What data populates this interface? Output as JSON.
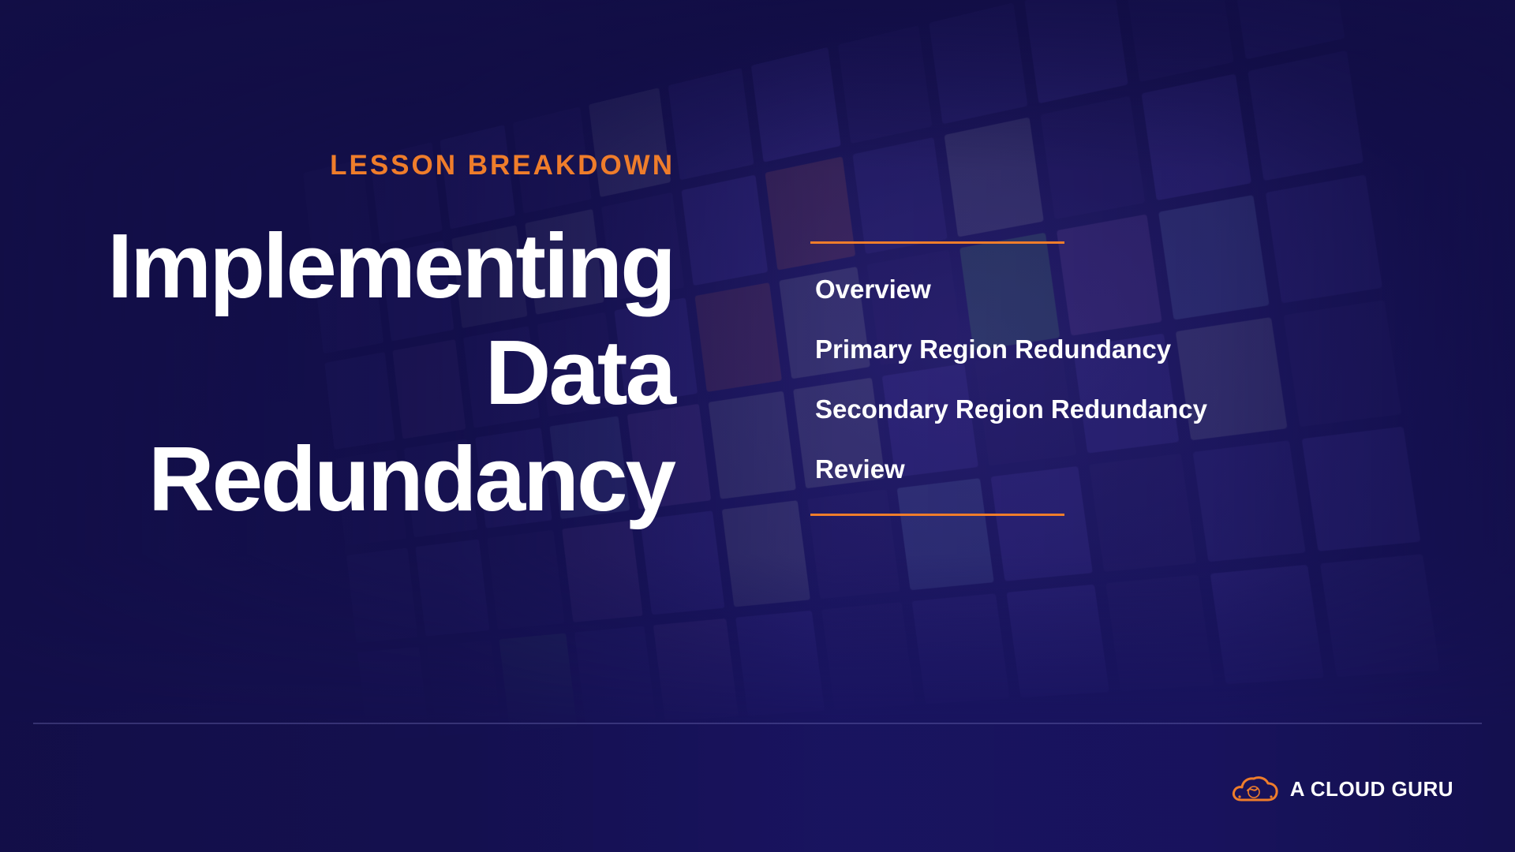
{
  "slide": {
    "eyebrow": "LESSON BREAKDOWN",
    "title_lines": [
      "Implementing",
      "Data",
      "Redundancy"
    ],
    "outline": [
      "Overview",
      "Primary Region Redundancy",
      "Secondary Region Redundancy",
      "Review"
    ]
  },
  "brand": {
    "name": "A CLOUD GURU",
    "logo_icon": "cloud-logo-icon"
  },
  "colors": {
    "background": "#16124f",
    "accent": "#ef7d2b",
    "text": "#ffffff"
  }
}
